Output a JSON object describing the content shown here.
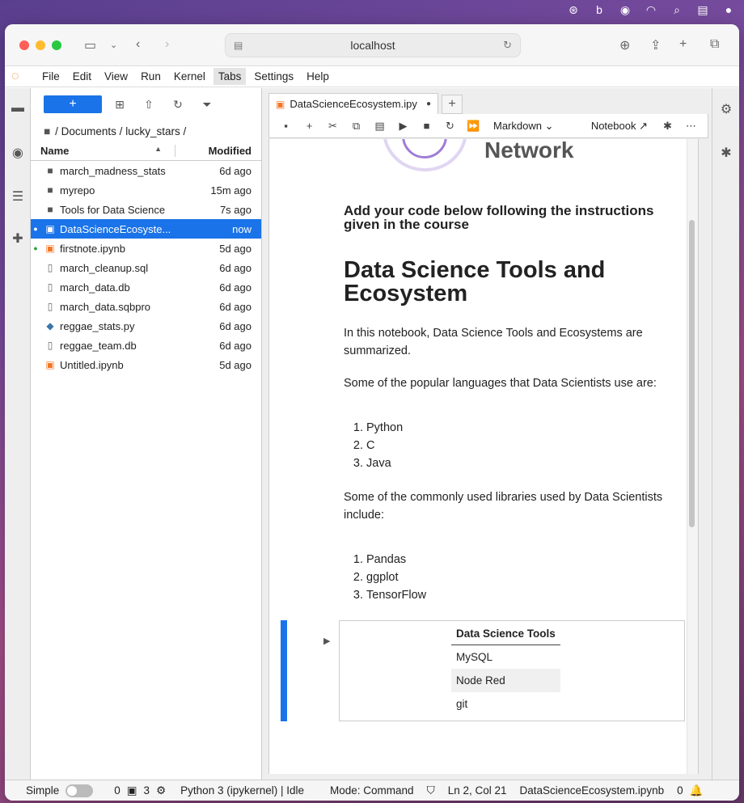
{
  "browser": {
    "url": "localhost"
  },
  "app_menu": {
    "items": [
      "File",
      "Edit",
      "View",
      "Run",
      "Kernel",
      "Tabs",
      "Settings",
      "Help"
    ],
    "active": "Tabs"
  },
  "file_browser": {
    "new_label": "+",
    "breadcrumb": "/ Documents / lucky_stars /",
    "columns": {
      "name": "Name",
      "modified": "Modified"
    },
    "files": [
      {
        "name": "march_madness_stats",
        "modified": "6d ago",
        "type": "folder"
      },
      {
        "name": "myrepo",
        "modified": "15m ago",
        "type": "folder"
      },
      {
        "name": "Tools for Data Science",
        "modified": "7s ago",
        "type": "folder"
      },
      {
        "name": "DataScienceEcosyste...",
        "modified": "now",
        "type": "notebook",
        "selected": true,
        "running": true
      },
      {
        "name": "firstnote.ipynb",
        "modified": "5d ago",
        "type": "notebook",
        "running": true
      },
      {
        "name": "march_cleanup.sql",
        "modified": "6d ago",
        "type": "file"
      },
      {
        "name": "march_data.db",
        "modified": "6d ago",
        "type": "file"
      },
      {
        "name": "march_data.sqbpro",
        "modified": "6d ago",
        "type": "file"
      },
      {
        "name": "reggae_stats.py",
        "modified": "6d ago",
        "type": "python"
      },
      {
        "name": "reggae_team.db",
        "modified": "6d ago",
        "type": "file"
      },
      {
        "name": "Untitled.ipynb",
        "modified": "5d ago",
        "type": "notebook"
      }
    ]
  },
  "notebook": {
    "tab_title": "DataScienceEcosystem.ipy",
    "cell_type": "Markdown",
    "kernel_label": "Notebook",
    "logo_text": "Network",
    "instruction": "Add your code below following the instructions given in the course",
    "title": "Data Science Tools and Ecosystem",
    "intro": "In this notebook, Data Science Tools and Ecosystems are summarized.",
    "languages_intro": "Some of the popular languages that Data Scientists use are:",
    "languages": [
      "Python",
      "C",
      "Java"
    ],
    "libraries_intro": "Some of the commonly used libraries used by Data Scientists include:",
    "libraries": [
      "Pandas",
      "ggplot",
      "TensorFlow"
    ],
    "tools_table": {
      "header": "Data Science Tools",
      "rows": [
        "MySQL",
        "Node Red",
        "git"
      ]
    }
  },
  "status_bar": {
    "mode_label": "Simple",
    "terminals": "0",
    "kernels": "3",
    "kernel_status": "Python 3 (ipykernel) | Idle",
    "mode": "Mode: Command",
    "cursor": "Ln 2, Col 21",
    "filename": "DataScienceEcosystem.ipynb",
    "notifications": "0"
  }
}
